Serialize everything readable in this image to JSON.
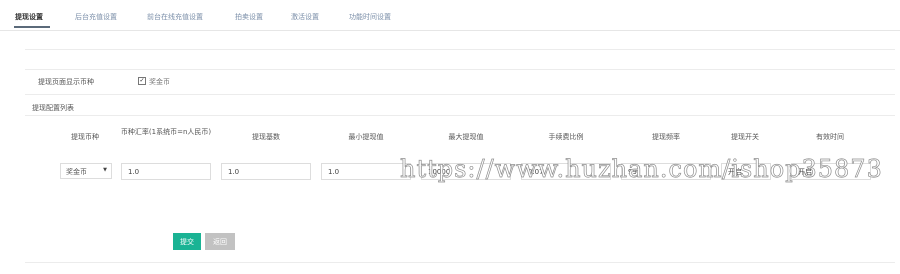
{
  "tabs": [
    {
      "label": "提现设置",
      "active": true
    },
    {
      "label": "后台充值设置"
    },
    {
      "label": "前台在线充值设置"
    },
    {
      "label": "拍卖设置"
    },
    {
      "label": "激活设置"
    },
    {
      "label": "功能时间设置"
    }
  ],
  "form": {
    "display_label": "提现页面显示币种",
    "display_option": "奖金币",
    "display_checked": true,
    "config_list_title": "提现配置列表"
  },
  "table": {
    "headers": [
      "提现币种",
      "币种汇率(1系统币=n人民币)",
      "提现基数",
      "最小提现值",
      "最大提现值",
      "手续费比例",
      "提现频率",
      "提现开关",
      "有效时间"
    ],
    "row": {
      "currency": "奖金币",
      "rate": "1.0",
      "base": "1.0",
      "min": "1.0",
      "max": "10000",
      "fee": "0.07",
      "frequency": "99",
      "switch": "开启",
      "valid_time": "开启"
    }
  },
  "buttons": {
    "submit": "提交",
    "back": "返回"
  },
  "watermark": "https://www.huzhan.com/ishop35873",
  "colors": {
    "accent": "#1ab394",
    "back_button": "#c2c2c2",
    "tab_text": "#7a8ea8"
  }
}
